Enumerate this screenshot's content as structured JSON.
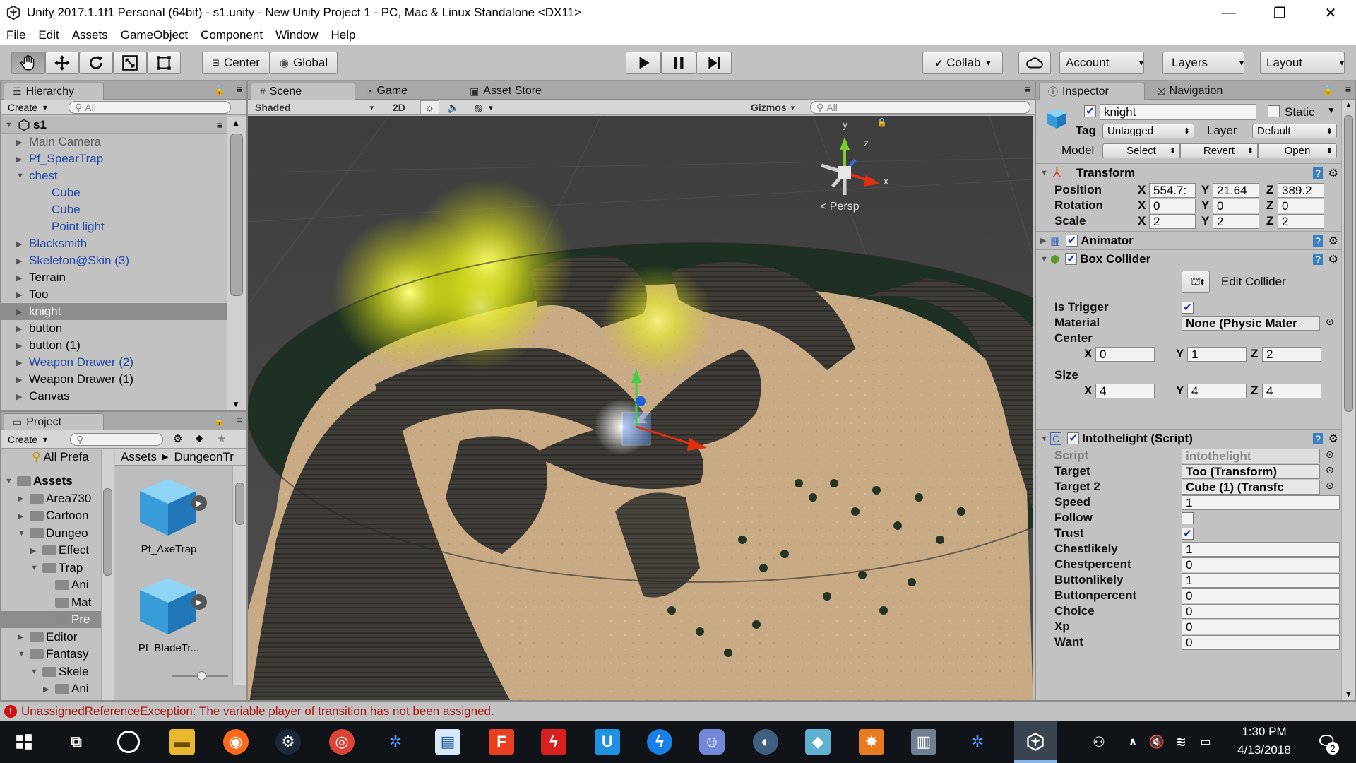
{
  "window": {
    "title": "Unity 2017.1.1f1 Personal (64bit) - s1.unity - New Unity Project 1 - PC, Mac & Linux Standalone <DX11>",
    "controls": [
      "—",
      "❐",
      "✕"
    ]
  },
  "menu": [
    "File",
    "Edit",
    "Assets",
    "GameObject",
    "Component",
    "Window",
    "Help"
  ],
  "toolbar": {
    "pivot": "Center",
    "space": "Global",
    "collab": "Collab",
    "account": "Account",
    "layers": "Layers",
    "layout": "Layout"
  },
  "hierarchy": {
    "tab": "Hierarchy",
    "create": "Create",
    "search_placeholder": "All",
    "scene": "s1",
    "items": [
      {
        "label": "Main Camera",
        "color": "gray"
      },
      {
        "label": "Pf_SpearTrap",
        "color": "blue"
      },
      {
        "label": "chest",
        "color": "blue"
      },
      {
        "label": "Cube",
        "color": "blue"
      },
      {
        "label": "Cube",
        "color": "blue"
      },
      {
        "label": "Point light",
        "color": "blue"
      },
      {
        "label": "Blacksmith",
        "color": "blue"
      },
      {
        "label": "Skeleton@Skin (3)",
        "color": "blue"
      },
      {
        "label": "Terrain",
        "color": "black"
      },
      {
        "label": "Too",
        "color": "black"
      },
      {
        "label": "knight",
        "color": "selected"
      },
      {
        "label": "button",
        "color": "black"
      },
      {
        "label": "button (1)",
        "color": "black"
      },
      {
        "label": "Weapon Drawer (2)",
        "color": "blue"
      },
      {
        "label": "Weapon Drawer (1)",
        "color": "black"
      },
      {
        "label": "Canvas",
        "color": "black"
      }
    ]
  },
  "project": {
    "tab": "Project",
    "create": "Create",
    "favorites": "All Prefa",
    "breadcrumb": [
      "Assets",
      "DungeonTr"
    ],
    "tree": [
      {
        "label": "Assets",
        "bold": true
      },
      {
        "label": "Area730"
      },
      {
        "label": "Cartoon"
      },
      {
        "label": "Dungeo"
      },
      {
        "label": "Effect"
      },
      {
        "label": "Trap"
      },
      {
        "label": "Ani"
      },
      {
        "label": "Mat"
      },
      {
        "label": "Pre"
      },
      {
        "label": "Editor"
      },
      {
        "label": "Fantasy"
      },
      {
        "label": "Skele"
      },
      {
        "label": "Ani"
      }
    ],
    "assets": [
      "Pf_AxeTrap",
      "Pf_BladeTr..."
    ]
  },
  "scene_tabs": {
    "scene": "Scene",
    "game": "Game",
    "asset_store": "Asset Store",
    "shading": "Shaded",
    "mode2d": "2D",
    "gizmos": "Gizmos",
    "search_placeholder": "All",
    "persp": "Persp",
    "axis_x": "x",
    "axis_y": "y",
    "axis_z": "z"
  },
  "inspector": {
    "tab": "Inspector",
    "nav_tab": "Navigation",
    "name": "knight",
    "static_label": "Static",
    "tag_label": "Tag",
    "tag": "Untagged",
    "layer_label": "Layer",
    "layer": "Default",
    "model_label": "Model",
    "model_buttons": [
      "Select",
      "Revert",
      "Open"
    ],
    "transform": {
      "title": "Transform",
      "position_label": "Position",
      "rotation_label": "Rotation",
      "scale_label": "Scale",
      "position": [
        "554.7:",
        "21.64",
        "389.2"
      ],
      "rotation": [
        "0",
        "0",
        "0"
      ],
      "scale": [
        "2",
        "2",
        "2"
      ]
    },
    "animator": "Animator",
    "box_collider": {
      "title": "Box Collider",
      "edit": "Edit Collider",
      "is_trigger_label": "Is Trigger",
      "material_label": "Material",
      "material": "None (Physic Mater",
      "center_label": "Center",
      "center": [
        "0",
        "1",
        "2"
      ],
      "size_label": "Size",
      "size": [
        "4",
        "4",
        "4"
      ]
    },
    "script": {
      "title": "Intothelight (Script)",
      "fields": [
        {
          "label": "Script",
          "value": "intothelight",
          "kind": "ro"
        },
        {
          "label": "Target",
          "value": "Too (Transform)",
          "kind": "obj"
        },
        {
          "label": "Target 2",
          "value": "Cube (1) (Transfc",
          "kind": "obj"
        },
        {
          "label": "Speed",
          "value": "1",
          "kind": "text"
        },
        {
          "label": "Follow",
          "value": "",
          "kind": "check"
        },
        {
          "label": "Trust",
          "value": "✔",
          "kind": "check"
        },
        {
          "label": "Chestlikely",
          "value": "1",
          "kind": "text"
        },
        {
          "label": "Chestpercent",
          "value": "0",
          "kind": "text"
        },
        {
          "label": "Buttonlikely",
          "value": "1",
          "kind": "text"
        },
        {
          "label": "Buttonpercent",
          "value": "0",
          "kind": "text"
        },
        {
          "label": "Choice",
          "value": "0",
          "kind": "text"
        },
        {
          "label": "Xp",
          "value": "0",
          "kind": "text"
        },
        {
          "label": "Want",
          "value": "0",
          "kind": "text"
        }
      ]
    }
  },
  "status": {
    "message": "UnassignedReferenceException: The variable player of transition has not been assigned."
  },
  "taskbar": {
    "time": "1:30 PM",
    "date": "4/13/2018",
    "notifications": "2"
  },
  "colors": {
    "unity_bg": "#c2c2c2",
    "selection": "#8d8d8d",
    "prefab_blue": "#2248a8",
    "error": "#b01010",
    "taskbar": "#101418"
  }
}
